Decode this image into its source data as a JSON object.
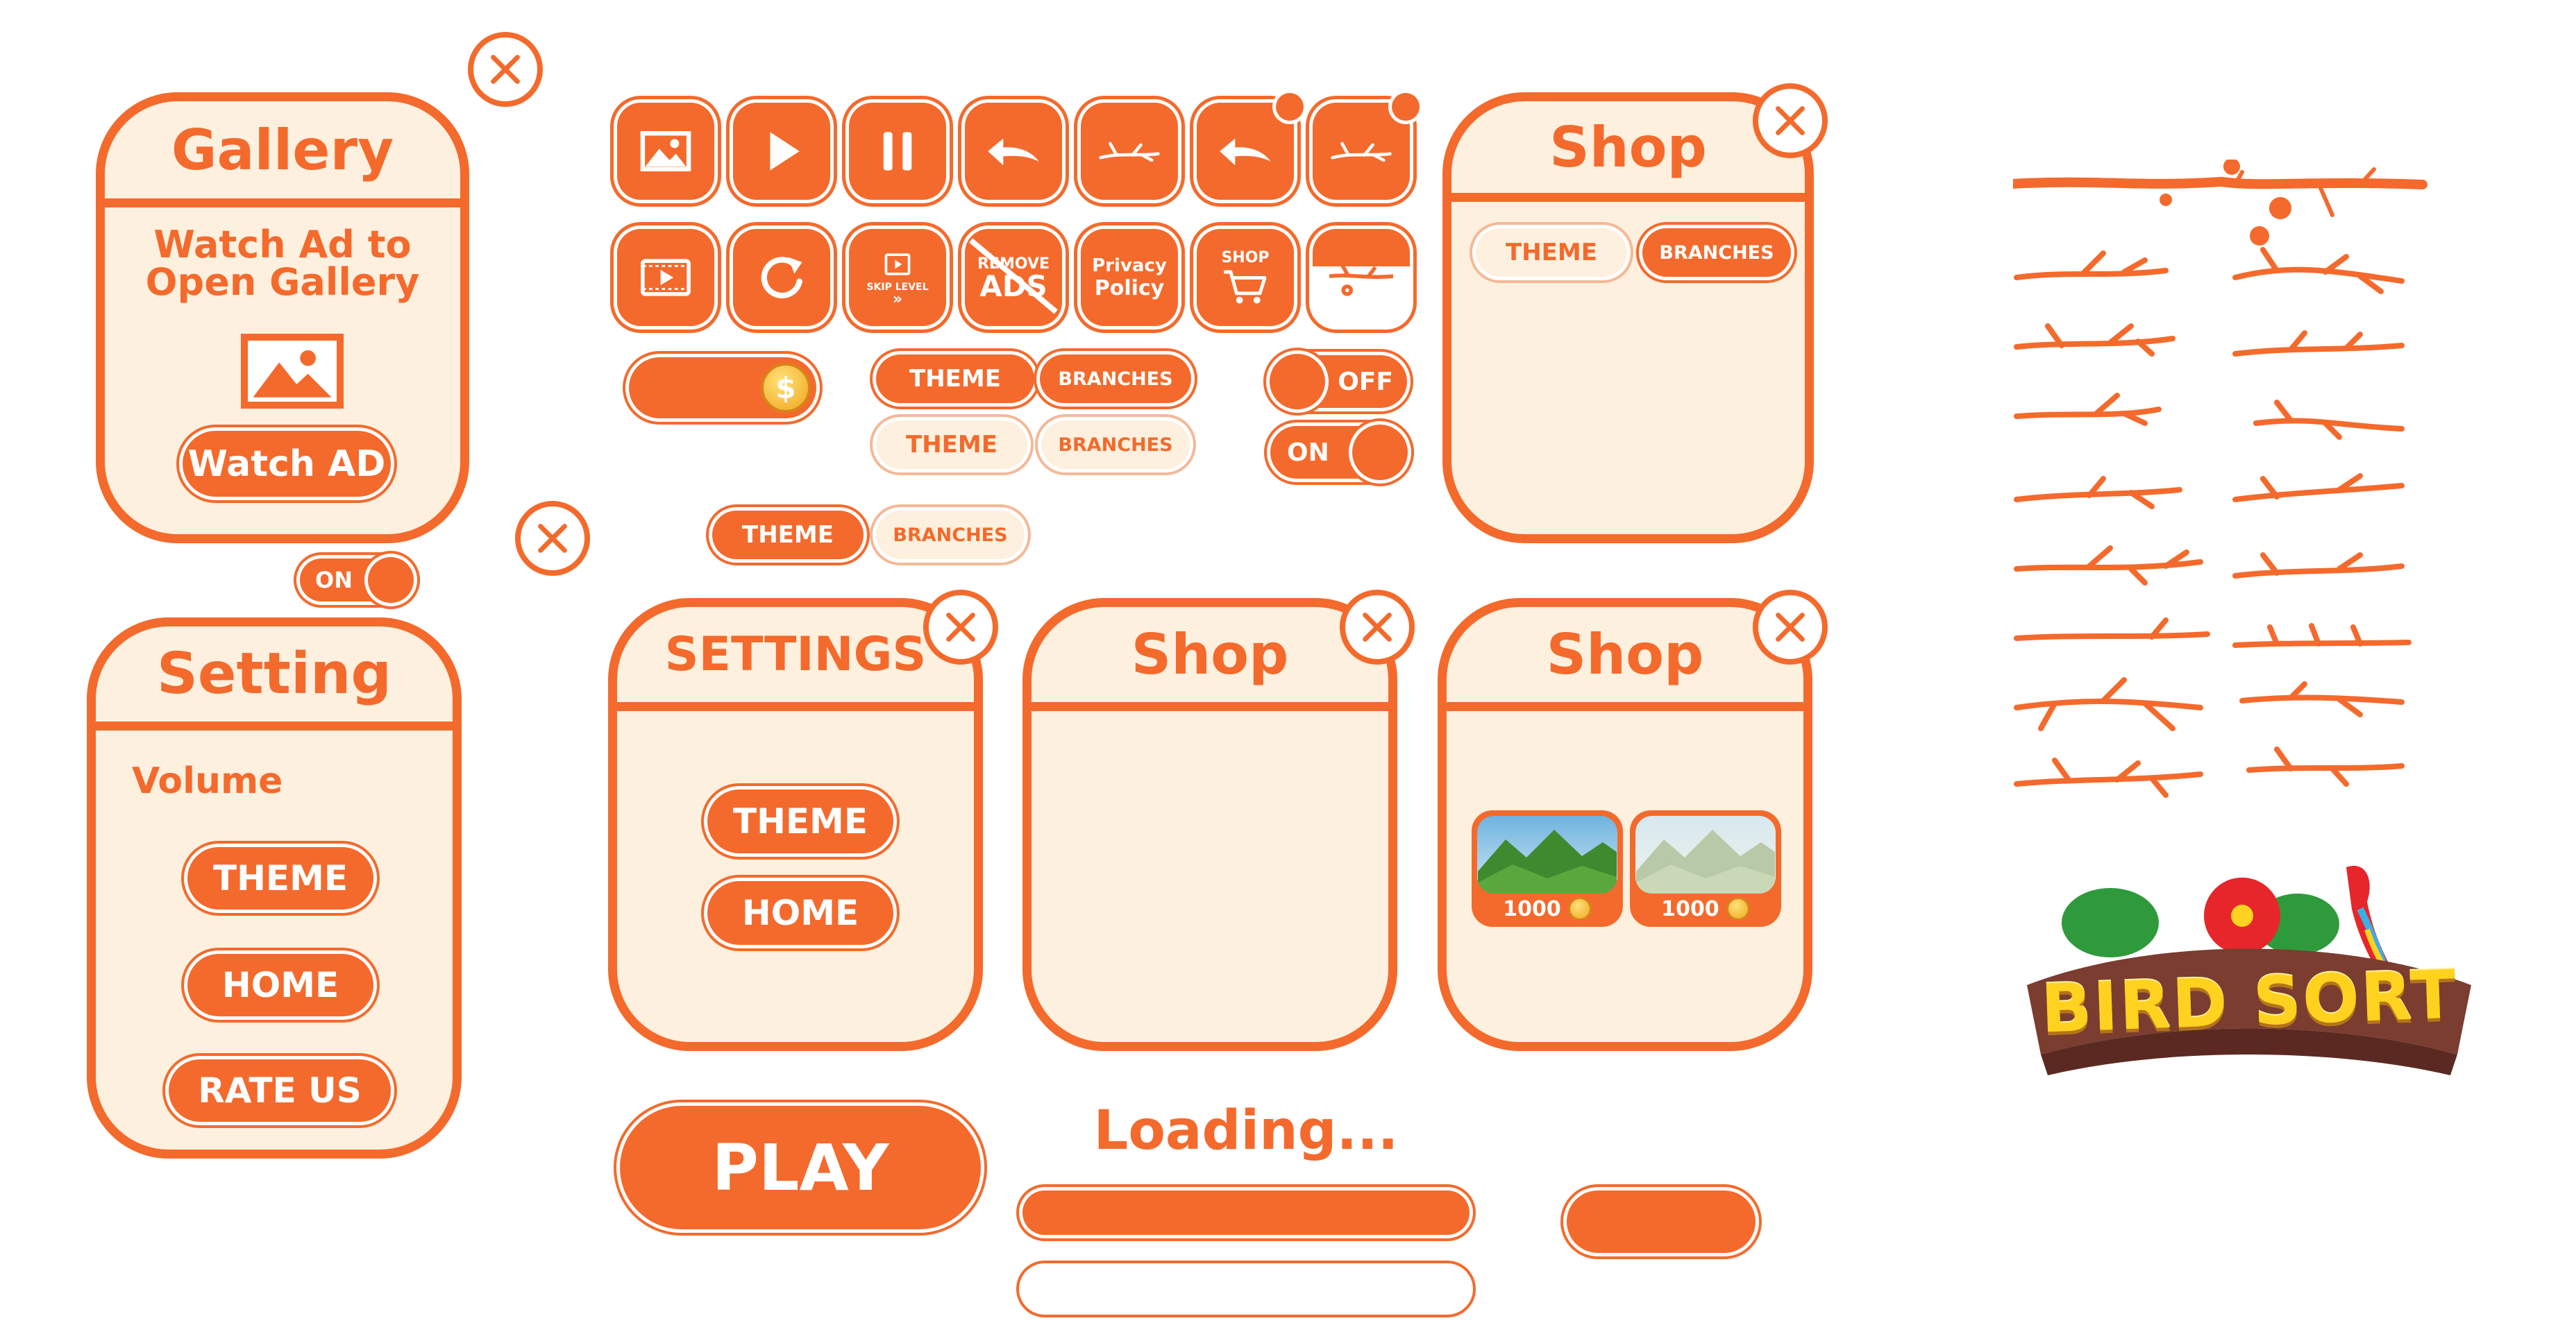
{
  "gallery_panel": {
    "title": "Gallery",
    "message_line1": "Watch Ad to",
    "message_line2": "Open Gallery",
    "image_icon": "image-icon",
    "button_label": "Watch AD"
  },
  "small_toggle_on": {
    "label": "ON"
  },
  "setting_panel": {
    "title": "Setting",
    "volume_label": "Volume",
    "buttons": [
      "THEME",
      "HOME",
      "RATE US"
    ]
  },
  "icon_buttons_row1": [
    "image-icon",
    "play-icon",
    "pause-icon",
    "back-arrow-icon",
    "branch-icon",
    "back-arrow-icon",
    "branch-icon"
  ],
  "icon_buttons_row2": {
    "video_icon": "film-icon",
    "restart_icon": "restart-icon",
    "skip_level": "SKIP LEVEL",
    "remove_ads_line1": "REMOVE",
    "remove_ads_line2": "ADS",
    "privacy_line1": "Privacy",
    "privacy_line2": "Policy",
    "shop_label": "SHOP",
    "branch_flower_icon": "branch-flower-icon"
  },
  "tabs": {
    "theme": "THEME",
    "branches": "BRANCHES"
  },
  "toggles": {
    "off_label": "OFF",
    "on_label": "ON"
  },
  "shop_panel_top": {
    "title": "Shop",
    "tabs": [
      "THEME",
      "BRANCHES"
    ]
  },
  "settings_panel": {
    "title": "SETTINGS",
    "buttons": [
      "THEME",
      "HOME"
    ]
  },
  "shop_panel_empty": {
    "title": "Shop"
  },
  "shop_panel_items": {
    "title": "Shop",
    "items": [
      {
        "price": "1000"
      },
      {
        "price": "1000"
      }
    ]
  },
  "play_button": {
    "label": "PLAY"
  },
  "loading": {
    "label": "Loading...",
    "progress": 1.0
  },
  "logo": {
    "text": "BIRD SORT"
  },
  "colors": {
    "accent": "#f46a2c",
    "cream": "#fdf0df",
    "logo_yellow": "#ffd21f",
    "logo_wood": "#7a3d2f"
  }
}
